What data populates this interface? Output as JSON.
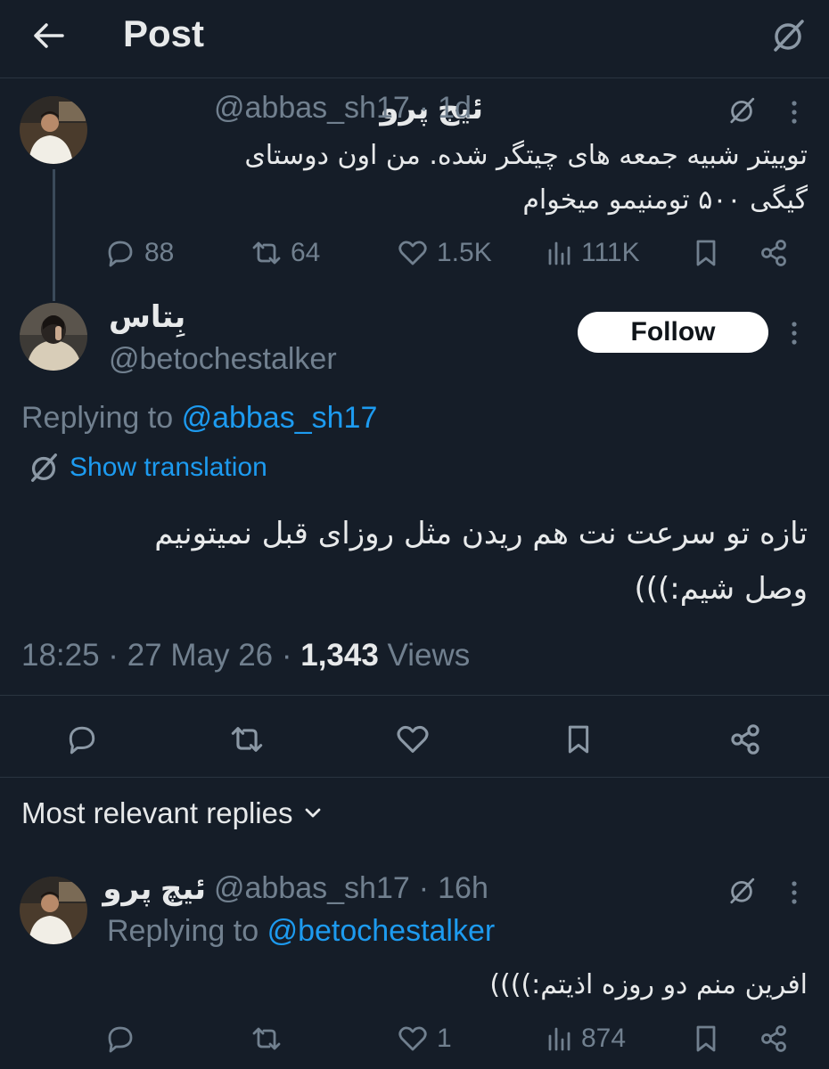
{
  "header": {
    "title": "Post"
  },
  "parent_tweet": {
    "display_name": "ئیچ پرو",
    "handle": "@abbas_sh17",
    "time": "1d",
    "text_line1": "توییتر شبیه جمعه های چیتگر شده. من اون دوستای",
    "text_line2": "گیگی ۵۰۰ تومنیمو میخوام",
    "replies": "88",
    "reposts": "64",
    "likes": "1.5K",
    "views": "111K"
  },
  "main_tweet": {
    "display_name": "بِتاس",
    "handle": "@betochestalker",
    "follow_label": "Follow",
    "replying_prefix": "Replying to",
    "replying_to": "@abbas_sh17",
    "show_translation": "Show translation",
    "text_line1": "تازه تو سرعت نت هم ریدن مثل روزای قبل نمیتونیم",
    "text_line2": "وصل شیم:)))",
    "timestamp": "18:25 · 27 May 26 · ",
    "views_count": "1,343",
    "views_label": " Views"
  },
  "replies_section": {
    "label": "Most relevant replies"
  },
  "reply_tweet": {
    "display_name": "ئیچ پرو",
    "handle": "@abbas_sh17",
    "time": "16h",
    "replying_prefix": "Replying to",
    "replying_to": "@betochestalker",
    "text": "افرین منم دو روزه اذیتم:))))",
    "likes": "1",
    "views": "874"
  },
  "colors": {
    "background": "#151d28",
    "accent": "#1d9bf0",
    "muted": "#71808f",
    "text": "#e7e9ea"
  },
  "icons": [
    "back-arrow-icon",
    "grok-icon",
    "more-icon",
    "reply-icon",
    "repost-icon",
    "like-icon",
    "views-icon",
    "bookmark-icon",
    "share-icon",
    "translate-icon",
    "chevron-down-icon"
  ]
}
